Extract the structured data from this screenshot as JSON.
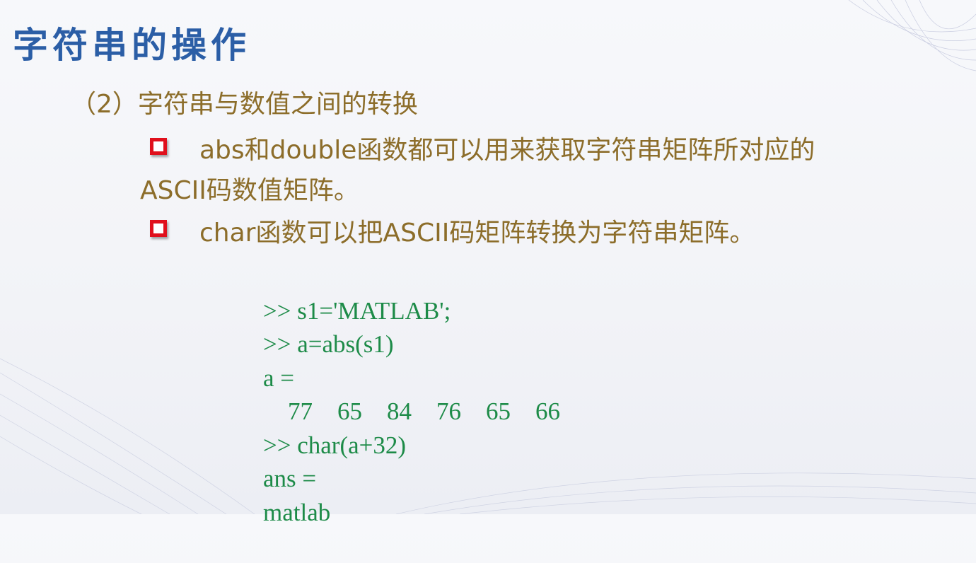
{
  "colors": {
    "title": "#2b5ea6",
    "body": "#8c6d2a",
    "code": "#1d8b48",
    "bullet": "#e0101c"
  },
  "slide": {
    "title": "字符串的操作",
    "subtitle": "（2）字符串与数值之间的转换",
    "bullets": [
      {
        "icon": "square-bullet-icon",
        "line1": "abs和double函数都可以用来获取字符串矩阵所对应的",
        "line2": "ASCII码数值矩阵。"
      },
      {
        "icon": "square-bullet-icon",
        "line1": "char函数可以把ASCII码矩阵转换为字符串矩阵。"
      }
    ],
    "code": [
      ">> s1='MATLAB';",
      ">> a=abs(s1)",
      "a =",
      "    77    65    84    76    65    66",
      ">> char(a+32)",
      "ans =",
      "matlab"
    ]
  }
}
